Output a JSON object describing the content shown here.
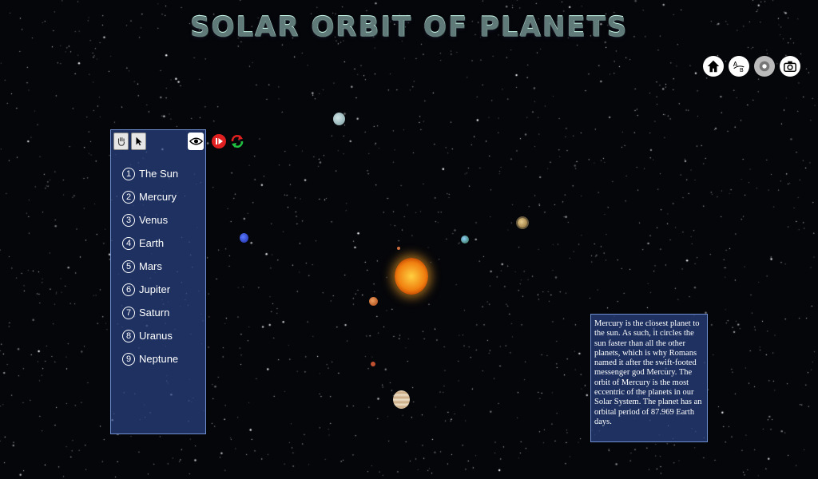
{
  "title": "SOLAR ORBIT OF PLANETS",
  "top_icons": [
    "home-icon",
    "ab-label-icon",
    "settings-icon",
    "camera-icon"
  ],
  "panel": {
    "tools": [
      "hand-icon",
      "pointer-icon"
    ],
    "planets": [
      {
        "num": "1",
        "label": "The Sun"
      },
      {
        "num": "2",
        "label": "Mercury"
      },
      {
        "num": "3",
        "label": "Venus"
      },
      {
        "num": "4",
        "label": "Earth"
      },
      {
        "num": "5",
        "label": "Mars"
      },
      {
        "num": "6",
        "label": "Jupiter"
      },
      {
        "num": "7",
        "label": "Saturn"
      },
      {
        "num": "8",
        "label": "Uranus"
      },
      {
        "num": "9",
        "label": "Neptune"
      }
    ]
  },
  "info": {
    "text": "Mercury is the closest planet to the sun. As such, it circles the sun faster than all the other planets, which is why Romans named it after the swift-footed messenger god Mercury. The orbit of Mercury is the most eccentric of the planets in our Solar System. The planet has an orbital period of 87.969 Earth days."
  },
  "colors": {
    "panel_bg": "#2a4282",
    "panel_border": "#6f8fd0",
    "sun": "#f0a020",
    "play_button": "#e02020"
  }
}
